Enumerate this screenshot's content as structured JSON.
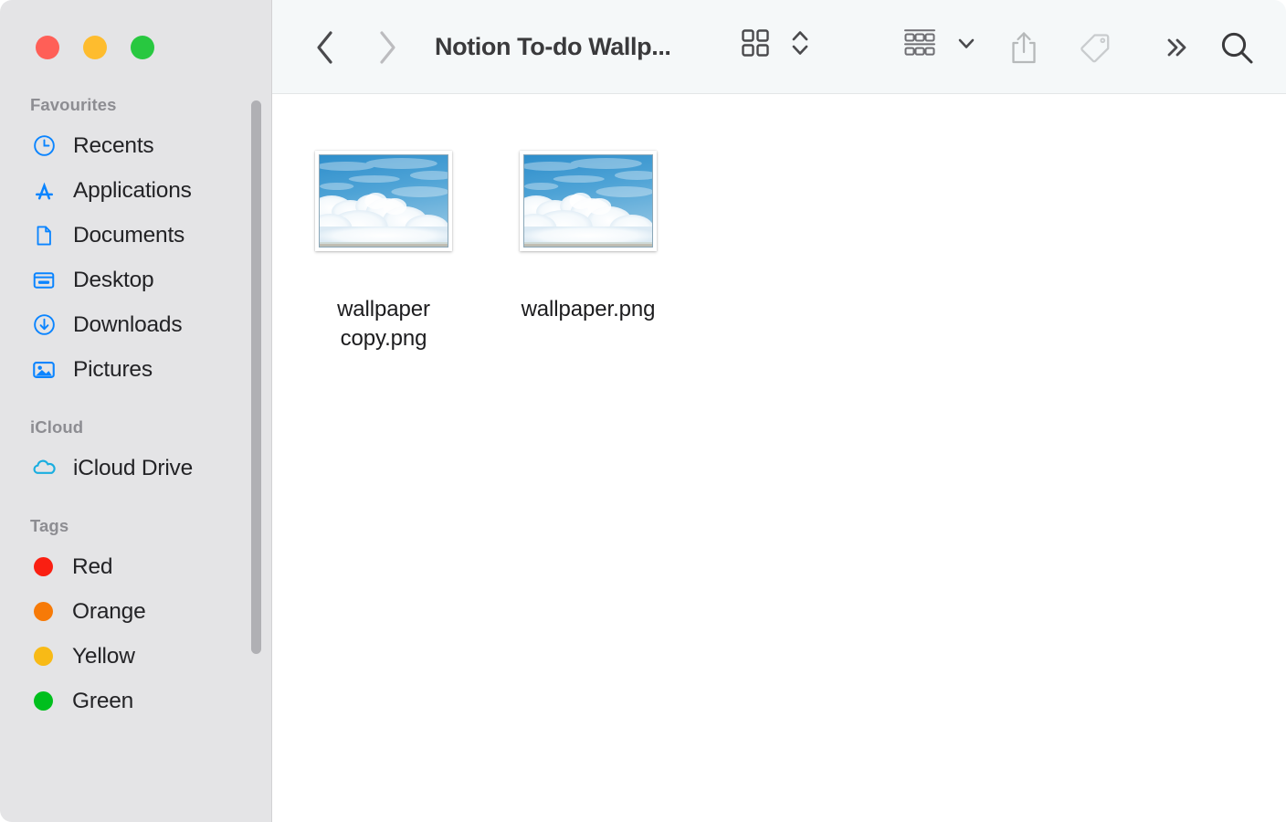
{
  "window": {
    "traffic_lights": [
      {
        "name": "close",
        "color": "#ff5f57"
      },
      {
        "name": "minimize",
        "color": "#febc2e"
      },
      {
        "name": "zoom",
        "color": "#28c840"
      }
    ]
  },
  "toolbar": {
    "back_label": "Back",
    "forward_label": "Forward",
    "folder_title": "Notion To-do Wallp...",
    "icon_view_label": "Icon view",
    "view_stepper_label": "Change item arrangement",
    "group_label": "Group items",
    "group_chevron_label": "Group options",
    "share_label": "Share",
    "tag_label": "Tags",
    "more_label": "More toolbar items",
    "search_label": "Search",
    "colors": {
      "bar_background": "#f5f8f9",
      "enabled_glyph": "#4a4a4d",
      "disabled_glyph": "#bcbcbf",
      "title_text": "#3a3a3c"
    }
  },
  "sidebar": {
    "background": "#e4e4e6",
    "sections": [
      {
        "title": "Favourites",
        "items": [
          {
            "label": "Recents",
            "icon": "clock-icon",
            "color": "#0a84ff"
          },
          {
            "label": "Applications",
            "icon": "app-store-a-icon",
            "color": "#0a84ff"
          },
          {
            "label": "Documents",
            "icon": "document-icon",
            "color": "#0a84ff"
          },
          {
            "label": "Desktop",
            "icon": "desktop-icon",
            "color": "#0a84ff"
          },
          {
            "label": "Downloads",
            "icon": "download-icon",
            "color": "#0a84ff"
          },
          {
            "label": "Pictures",
            "icon": "photo-icon",
            "color": "#0a84ff"
          }
        ]
      },
      {
        "title": "iCloud",
        "items": [
          {
            "label": "iCloud Drive",
            "icon": "cloud-icon",
            "color": "#1aaee0"
          }
        ]
      },
      {
        "title": "Tags",
        "items": [
          {
            "label": "Red",
            "icon": "tag-dot-icon",
            "color": "#fa1f12"
          },
          {
            "label": "Orange",
            "icon": "tag-dot-icon",
            "color": "#f77a07"
          },
          {
            "label": "Yellow",
            "icon": "tag-dot-icon",
            "color": "#f8ba16"
          },
          {
            "label": "Green",
            "icon": "tag-dot-icon",
            "color": "#00bf1d"
          }
        ]
      }
    ]
  },
  "files": [
    {
      "name": "wallpaper copy.png",
      "kind": "png-image",
      "thumbnail": "sky-clouds"
    },
    {
      "name": "wallpaper.png",
      "kind": "png-image",
      "thumbnail": "sky-clouds"
    }
  ]
}
